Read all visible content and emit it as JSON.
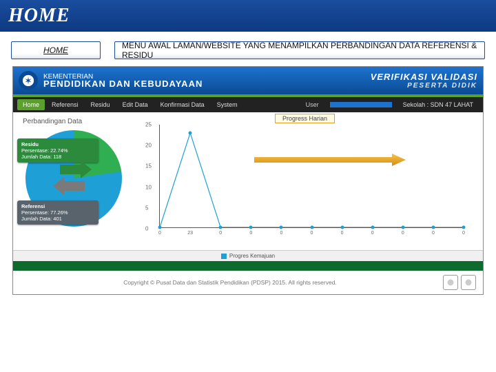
{
  "slide": {
    "banner": "HOME",
    "home_btn": "HOME",
    "desc": "MENU AWAL LAMAN/WEBSITE YANG MENAMPILKAN PERBANDINGAN DATA REFERENSI & RESIDU"
  },
  "app_header": {
    "ministry_small": "KEMENTERIAN",
    "ministry_big": "PENDIDIKAN DAN KEBUDAYAAN",
    "verif_l1": "VERIFIKASI VALIDASI",
    "verif_l2": "PESERTA DIDIK"
  },
  "menu": {
    "items": [
      "Home",
      "Referensi",
      "Residu",
      "Edit Data",
      "Konfirmasi Data",
      "System"
    ],
    "active_index": 0,
    "user_label": "User",
    "school": "Sekolah : SDN 47 LAHAT"
  },
  "left_panel": {
    "title": "Perbandingan Data",
    "residu": {
      "t": "Residu",
      "p": "Persentase: 22.74%",
      "j": "Jumlah Data: 118"
    },
    "referensi": {
      "t": "Referensi",
      "p": "Persentase: 77.26%",
      "j": "Jumlah Data: 401"
    }
  },
  "chart_data": {
    "type": "line",
    "title": "Progress Harian",
    "xlabel": "",
    "ylabel": "",
    "ylim": [
      0,
      25
    ],
    "yticks": [
      0,
      5,
      10,
      15,
      20,
      25
    ],
    "x": [
      1,
      2,
      3,
      4,
      5,
      6,
      7,
      8,
      9,
      10,
      11
    ],
    "values": [
      0,
      23,
      0,
      0,
      0,
      0,
      0,
      0,
      0,
      0,
      0
    ],
    "series_name": "Progres Kemajuan"
  },
  "legend": {
    "label": "Progres Kemajuan"
  },
  "footer": {
    "copyright": "Copyright © Pusat Data dan Statistik Pendidikan (PDSP) 2015. All rights reserved."
  }
}
